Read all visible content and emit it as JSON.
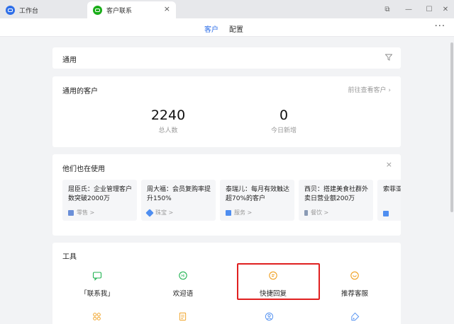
{
  "tabs": [
    {
      "label": "工作台"
    },
    {
      "label": "客户联系"
    }
  ],
  "tab_close": "×",
  "window_controls": [
    "⧉",
    "—",
    "☐",
    "✕"
  ],
  "nav": {
    "items": [
      {
        "label": "客户"
      },
      {
        "label": "配置"
      }
    ],
    "more": "···"
  },
  "general": {
    "title": "通用"
  },
  "customers": {
    "title": "通用的客户",
    "goto": "前往查看客户 ›",
    "total": "2240",
    "total_label": "总人数",
    "today": "0",
    "today_label": "今日新增"
  },
  "cases": {
    "title": "他们也在使用",
    "close": "×",
    "items": [
      {
        "text": "屈臣氏：企业管理客户数突破2000万",
        "tag": "零售  >",
        "tag_color": "#6a8fd8"
      },
      {
        "text": "周大福：会员复购率提升150%",
        "tag": "珠宝  >",
        "tag_color": "#4f8ef0"
      },
      {
        "text": "泰瑞儿：每月有效触达超70%的客户",
        "tag": "服务  >",
        "tag_color": "#4f8ef0"
      },
      {
        "text": "西贝：搭建美食社群外卖日营业额200万",
        "tag": "餐饮  >",
        "tag_color": "#8a9bb5"
      },
      {
        "text": "索菲亚提升",
        "tag": "",
        "tag_color": "#4f8ef0"
      }
    ]
  },
  "tools": {
    "title": "工具",
    "items": [
      {
        "label": "「联系我」",
        "color": "#21b352"
      },
      {
        "label": "欢迎语",
        "color": "#21b352"
      },
      {
        "label": "快捷回复",
        "color": "#f0a020"
      },
      {
        "label": "推荐客服",
        "color": "#f0a020"
      }
    ],
    "row2_colors": [
      "#f0a020",
      "#f0a020",
      "#4f8ef0",
      "#4f8ef0"
    ]
  }
}
